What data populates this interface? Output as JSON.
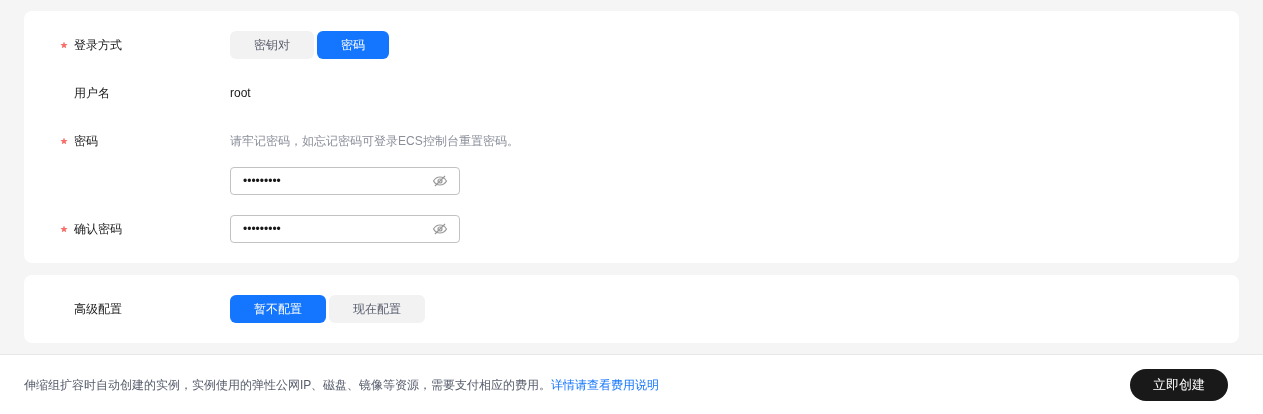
{
  "login": {
    "rows": [
      {
        "kind": "segmented",
        "label": "登录方式",
        "required": true,
        "options": [
          {
            "label": "密钥对",
            "selected": false
          },
          {
            "label": "密码",
            "selected": true
          }
        ]
      },
      {
        "kind": "text",
        "label": "用户名",
        "required": false,
        "value": "root"
      },
      {
        "kind": "password",
        "label": "密码",
        "required": true,
        "hint": "请牢记密码，如忘记密码可登录ECS控制台重置密码。",
        "value": "•••••••••"
      },
      {
        "kind": "password",
        "label": "确认密码",
        "required": true,
        "value": "•••••••••"
      }
    ]
  },
  "advanced": {
    "rows": [
      {
        "kind": "segmented",
        "label": "高级配置",
        "required": false,
        "options": [
          {
            "label": "暂不配置",
            "selected": true
          },
          {
            "label": "现在配置",
            "selected": false
          }
        ]
      }
    ]
  },
  "footer": {
    "notice": "伸缩组扩容时自动创建的实例，实例使用的弹性公网IP、磁盘、镜像等资源，需要支付相应的费用。",
    "link": "详情请查看费用说明",
    "button": "立即创建"
  }
}
